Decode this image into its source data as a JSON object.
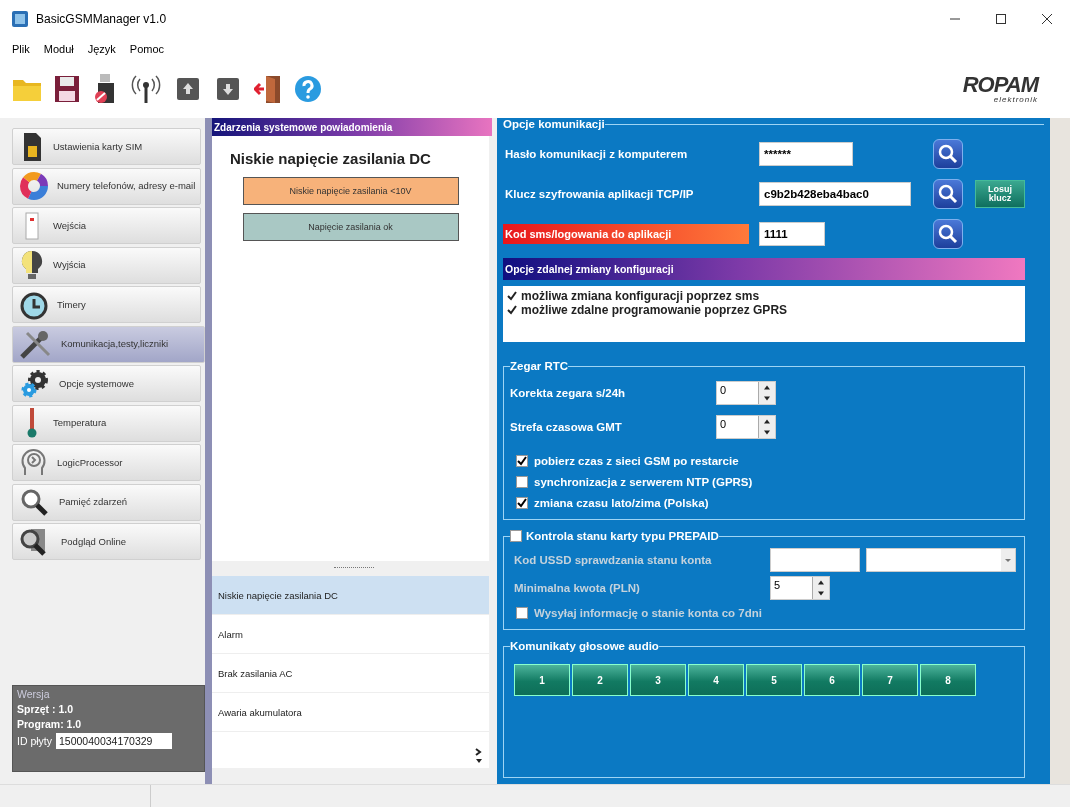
{
  "window": {
    "title": "BasicGSMManager v1.0"
  },
  "menu": [
    "Plik",
    "Moduł",
    "Język",
    "Pomoc"
  ],
  "logo": {
    "name": "ROPAM",
    "sub": "elektronik"
  },
  "sidebar": {
    "items": [
      {
        "label": "Ustawienia karty SIM",
        "selected": false
      },
      {
        "label": "Numery telefonów, adresy e-mail",
        "selected": false
      },
      {
        "label": "Wejścia",
        "selected": false
      },
      {
        "label": "Wyjścia",
        "selected": false
      },
      {
        "label": "Timery",
        "selected": false
      },
      {
        "label": "Komunikacja,testy,liczniki",
        "selected": true
      },
      {
        "label": "Opcje systemowe",
        "selected": false
      },
      {
        "label": "Temperatura",
        "selected": false
      },
      {
        "label": "LogicProcessor",
        "selected": false
      },
      {
        "label": "Pamięć zdarzeń",
        "selected": false
      },
      {
        "label": "Podgląd Online",
        "selected": false
      }
    ],
    "version": {
      "title": "Wersja",
      "hardware": "Sprzęt : 1.0",
      "software": "Program: 1.0",
      "board_id_label": "ID płyty",
      "board_id": "1500040034170329"
    }
  },
  "events": {
    "header": "Zdarzenia systemowe powiadomienia",
    "title": "Niskie napięcie zasilania DC",
    "states": [
      {
        "label": "Niskie napięcie zasilania <10V",
        "color": "#f7b27a"
      },
      {
        "label": "Napięcie zasilania ok",
        "color": "#a9c8c4"
      }
    ],
    "list": [
      {
        "label": "Niskie napięcie zasilania DC",
        "selected": true
      },
      {
        "label": "Alarm",
        "selected": false
      },
      {
        "label": "Brak zasilania AC",
        "selected": false
      },
      {
        "label": "Awaria akumulatora",
        "selected": false
      }
    ]
  },
  "communication": {
    "title": "Opcje komunikacji",
    "rows": [
      {
        "label": "Hasło komunikacji z komputerem",
        "value": "******",
        "highlighted": false
      },
      {
        "label": "Klucz szyfrowania aplikacji TCP/IP",
        "value": "c9b2b428eba4bac0",
        "button": "Losuj klucz",
        "highlighted": false
      },
      {
        "label": "Kod sms/logowania do aplikacji",
        "value": "1111",
        "highlighted": true
      }
    ],
    "remote": {
      "title": "Opcje zdalnej zmiany konfiguracji",
      "options": [
        {
          "label": "możliwa zmiana konfiguracji poprzez sms",
          "checked": true
        },
        {
          "label": "możliwe zdalne programowanie poprzez GPRS",
          "checked": true
        }
      ]
    }
  },
  "rtc": {
    "title": "Zegar RTC",
    "spinners": [
      {
        "label": "Korekta zegara s/24h",
        "value": "0"
      },
      {
        "label": "Strefa czasowa  GMT",
        "value": "0"
      }
    ],
    "options": [
      {
        "label": "pobierz czas z sieci GSM po restarcie",
        "checked": true
      },
      {
        "label": "synchronizacja z serwerem NTP (GPRS)",
        "checked": false
      },
      {
        "label": "zmiana czasu lato/zima (Polska)",
        "checked": true
      }
    ]
  },
  "prepaid": {
    "title": "Kontrola stanu karty typu PREPAID",
    "checked": false,
    "disabled": true,
    "ussd_label": "Kod USSD sprawdzania stanu konta",
    "min_label": "Minimalna kwota (PLN)",
    "min_value": "5",
    "notify": {
      "label": "Wysyłaj informację o stanie konta co 7dni",
      "checked": false
    }
  },
  "audio": {
    "title": "Komunikaty głosowe audio",
    "buttons": [
      "1",
      "2",
      "3",
      "4",
      "5",
      "6",
      "7",
      "8"
    ]
  }
}
